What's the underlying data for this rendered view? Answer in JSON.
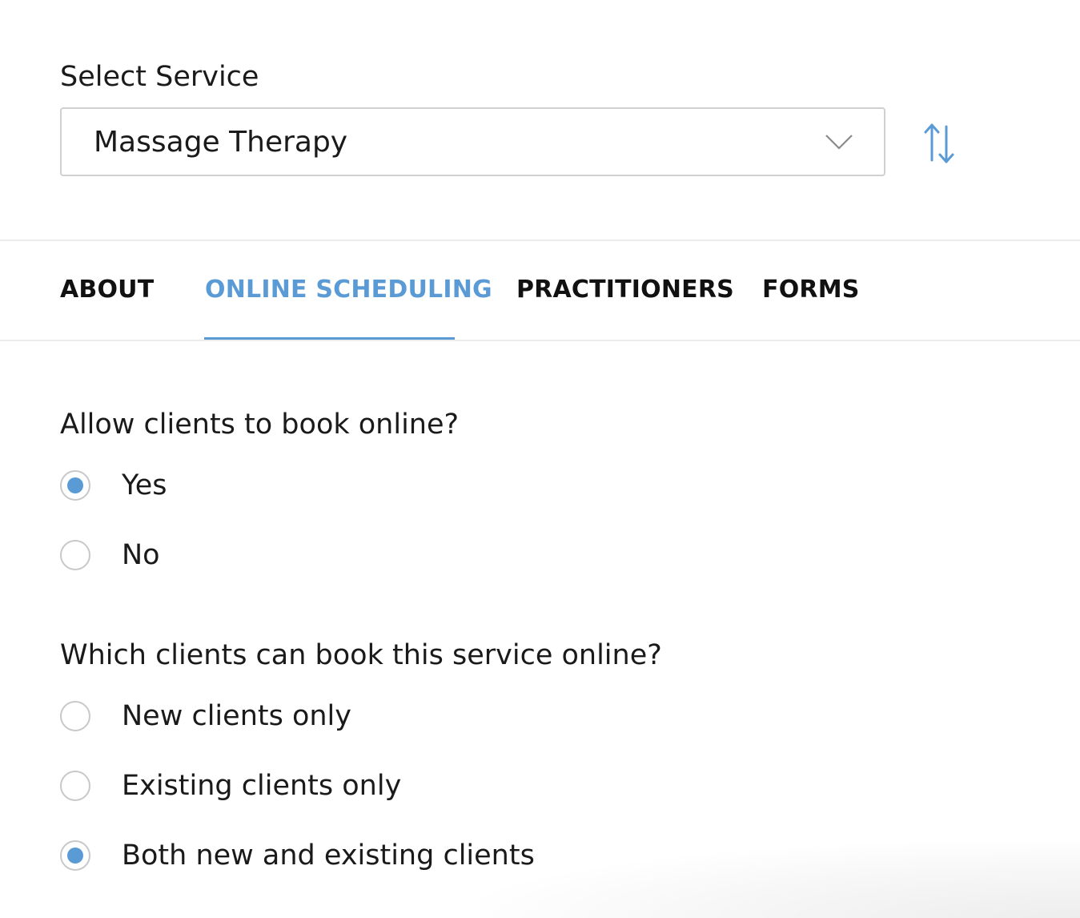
{
  "service": {
    "label": "Select Service",
    "selected": "Massage Therapy",
    "dropdown_icon": "chevron-down-icon",
    "sort_icon": "sort-arrows-icon"
  },
  "tabs": [
    {
      "label": "ABOUT",
      "active": false
    },
    {
      "label": "ONLINE SCHEDULING",
      "active": true
    },
    {
      "label": "PRACTITIONERS",
      "active": false
    },
    {
      "label": "FORMS",
      "active": false
    }
  ],
  "booking": {
    "question": "Allow clients to book online?",
    "options": [
      {
        "label": "Yes",
        "checked": true
      },
      {
        "label": "No",
        "checked": false
      }
    ]
  },
  "clients": {
    "question": "Which clients can book this service online?",
    "options": [
      {
        "label": "New clients only",
        "checked": false
      },
      {
        "label": "Existing clients only",
        "checked": false
      },
      {
        "label": "Both new and existing clients",
        "checked": true
      }
    ]
  },
  "colors": {
    "accent": "#5b9bd5",
    "text": "#1a1a1a",
    "border": "#d0d0d0",
    "divider": "#ececec"
  }
}
